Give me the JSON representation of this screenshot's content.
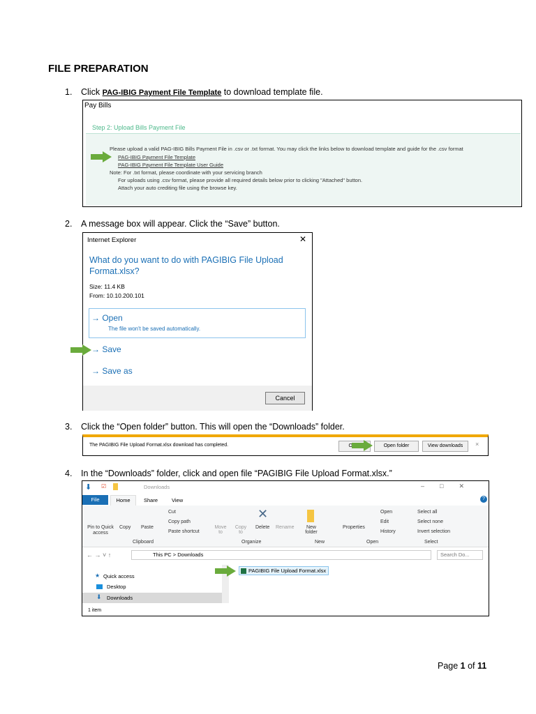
{
  "heading": "FILE PREPARATION",
  "steps": [
    {
      "num": "1.",
      "pre": "Click ",
      "link": "PAG-IBIG Payment File Template",
      "post": " to download template file."
    },
    {
      "num": "2.",
      "text": "A message box will appear. Click the “Save” button."
    },
    {
      "num": "3.",
      "text": "Click the “Open folder” button. This will open the “Downloads” folder."
    },
    {
      "num": "4.",
      "text": "In the “Downloads” folder, click and open file “PAGIBIG File Upload Format.xlsx.”"
    }
  ],
  "paybills": {
    "title": "Pay Bills",
    "step": "Step 2: Upload Bills Payment File",
    "intro": "Please upload a valid PAG-IBIG Bills Payment File in .csv or .txt format. You may click the links below to download template and guide for the .csv format",
    "link1": "PAG-IBIG Payment File Template",
    "link2": "PAG-IBIG Payment File Template User Guide",
    "note1": "Note: For .txt format, please coordinate with your servicing branch",
    "note2": "For uploads using .csv format, please provide all required details below prior to clicking \"Attached\" button.",
    "note3": "Attach your auto crediting file using the browse key."
  },
  "dialog": {
    "title": "Internet Explorer",
    "close": "✕",
    "question": "What do you want to do with PAGIBIG File Upload Format.xlsx?",
    "size": "Size: 11.4 KB",
    "from": "From: 10.10.200.101",
    "open": "Open",
    "open_sub": "The file won't be saved automatically.",
    "save": "Save",
    "save_as": "Save as",
    "cancel": "Cancel",
    "arrow": "→"
  },
  "download_bar": {
    "message": "The PAGIBIG File Upload Format.xlsx download has completed.",
    "open": "Open",
    "open_folder": "Open folder",
    "view": "View downloads",
    "close": "×"
  },
  "explorer": {
    "title": "Downloads",
    "tabs": [
      "File",
      "Home",
      "Share",
      "View"
    ],
    "clipboard": {
      "pin": "Pin to Quick access",
      "copy": "Copy",
      "paste": "Paste",
      "cut": "Cut",
      "copy_path": "Copy path",
      "paste_shortcut": "Paste shortcut",
      "group": "Clipboard"
    },
    "organize": {
      "move": "Move to",
      "copy": "Copy to",
      "delete": "Delete",
      "rename": "Rename",
      "group": "Organize"
    },
    "new": {
      "folder": "New folder",
      "group": "New"
    },
    "open": {
      "properties": "Properties",
      "open": "Open",
      "edit": "Edit",
      "history": "History",
      "group": "Open"
    },
    "select": {
      "all": "Select all",
      "none": "Select none",
      "invert": "Invert selection",
      "group": "Select"
    },
    "path": [
      "This PC",
      "Downloads"
    ],
    "search": "Search Do...",
    "nav": [
      "Quick access",
      "Desktop",
      "Downloads"
    ],
    "file": "PAGIBIG File Upload Format.xlsx",
    "status": "1 item"
  },
  "footer": {
    "pre": "Page ",
    "page": "1",
    "mid": " of ",
    "total": "11"
  }
}
